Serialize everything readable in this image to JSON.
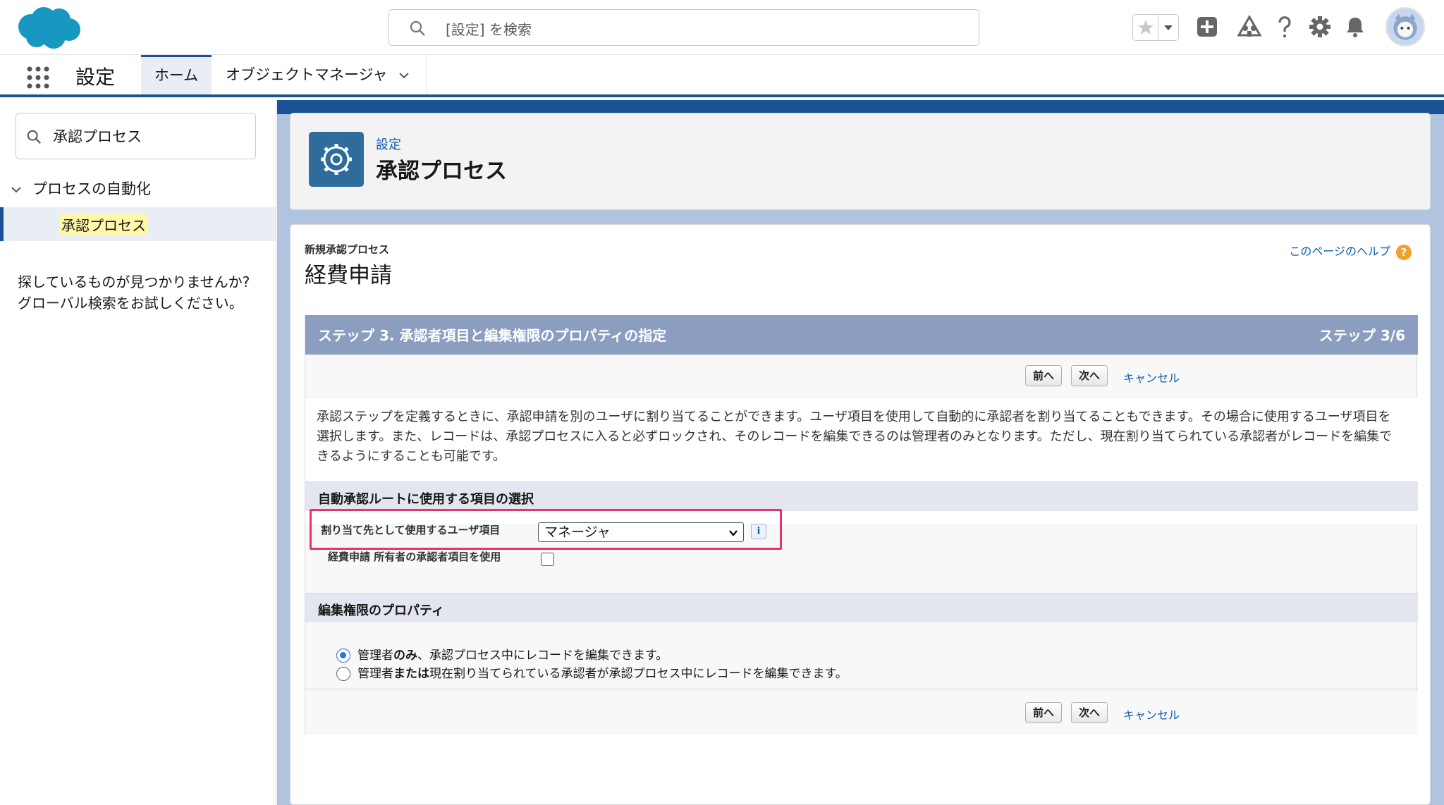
{
  "global_header": {
    "search_placeholder": "[設定] を検索"
  },
  "context_bar": {
    "app_name": "設定",
    "tabs": [
      {
        "label": "ホーム"
      },
      {
        "label": "オブジェクトマネージャ"
      }
    ]
  },
  "sidebar": {
    "quick_find_value": "承認プロセス",
    "tree_parent": "プロセスの自動化",
    "tree_child": "承認プロセス",
    "not_found_line1": "探しているものが見つかりませんか?",
    "not_found_line2": "グローバル検索をお試しください。"
  },
  "page_header": {
    "breadcrumb": "設定",
    "title": "承認プロセス"
  },
  "content": {
    "sub_label": "新規承認プロセス",
    "record_title": "経費申請",
    "help_link": "このページのヘルプ",
    "help_icon": "?",
    "step_title": "ステップ 3. 承認者項目と編集権限のプロパティの指定",
    "step_number": "ステップ 3/6",
    "btn_prev": "前へ",
    "btn_next": "次へ",
    "btn_cancel": "キャンセル",
    "description": "承認ステップを定義するときに、承認申請を別のユーザに割り当てることができます。ユーザ項目を使用して自動的に承認者を割り当てることもできます。その場合に使用するユーザ項目を選択します。また、レコードは、承認プロセスに入ると必ずロックされ、そのレコードを編集できるのは管理者のみとなります。ただし、現在割り当てられている承認者がレコードを編集できるようにすることも可能です。",
    "section_routing": "自動承認ルートに使用する項目の選択",
    "field_user_label": "割り当て先として使用するユーザ項目",
    "field_user_value": "マネージャ",
    "info_icon": "i",
    "field_owner_label": "経費申請 所有者の承認者項目を使用",
    "section_edit": "編集権限のプロパティ",
    "radio1_prefix": "管理者",
    "radio1_bold": "のみ",
    "radio1_suffix": "、承認プロセス中にレコードを編集できます。",
    "radio2_prefix": "管理者",
    "radio2_bold": "または",
    "radio2_suffix": "現在割り当てられている承認者が承認プロセス中にレコードを編集できます。"
  },
  "colors": {
    "brand": "#1b5297",
    "link": "#0b5cab",
    "highlight": "#e8336e",
    "step_header": "#8b9ec0"
  }
}
